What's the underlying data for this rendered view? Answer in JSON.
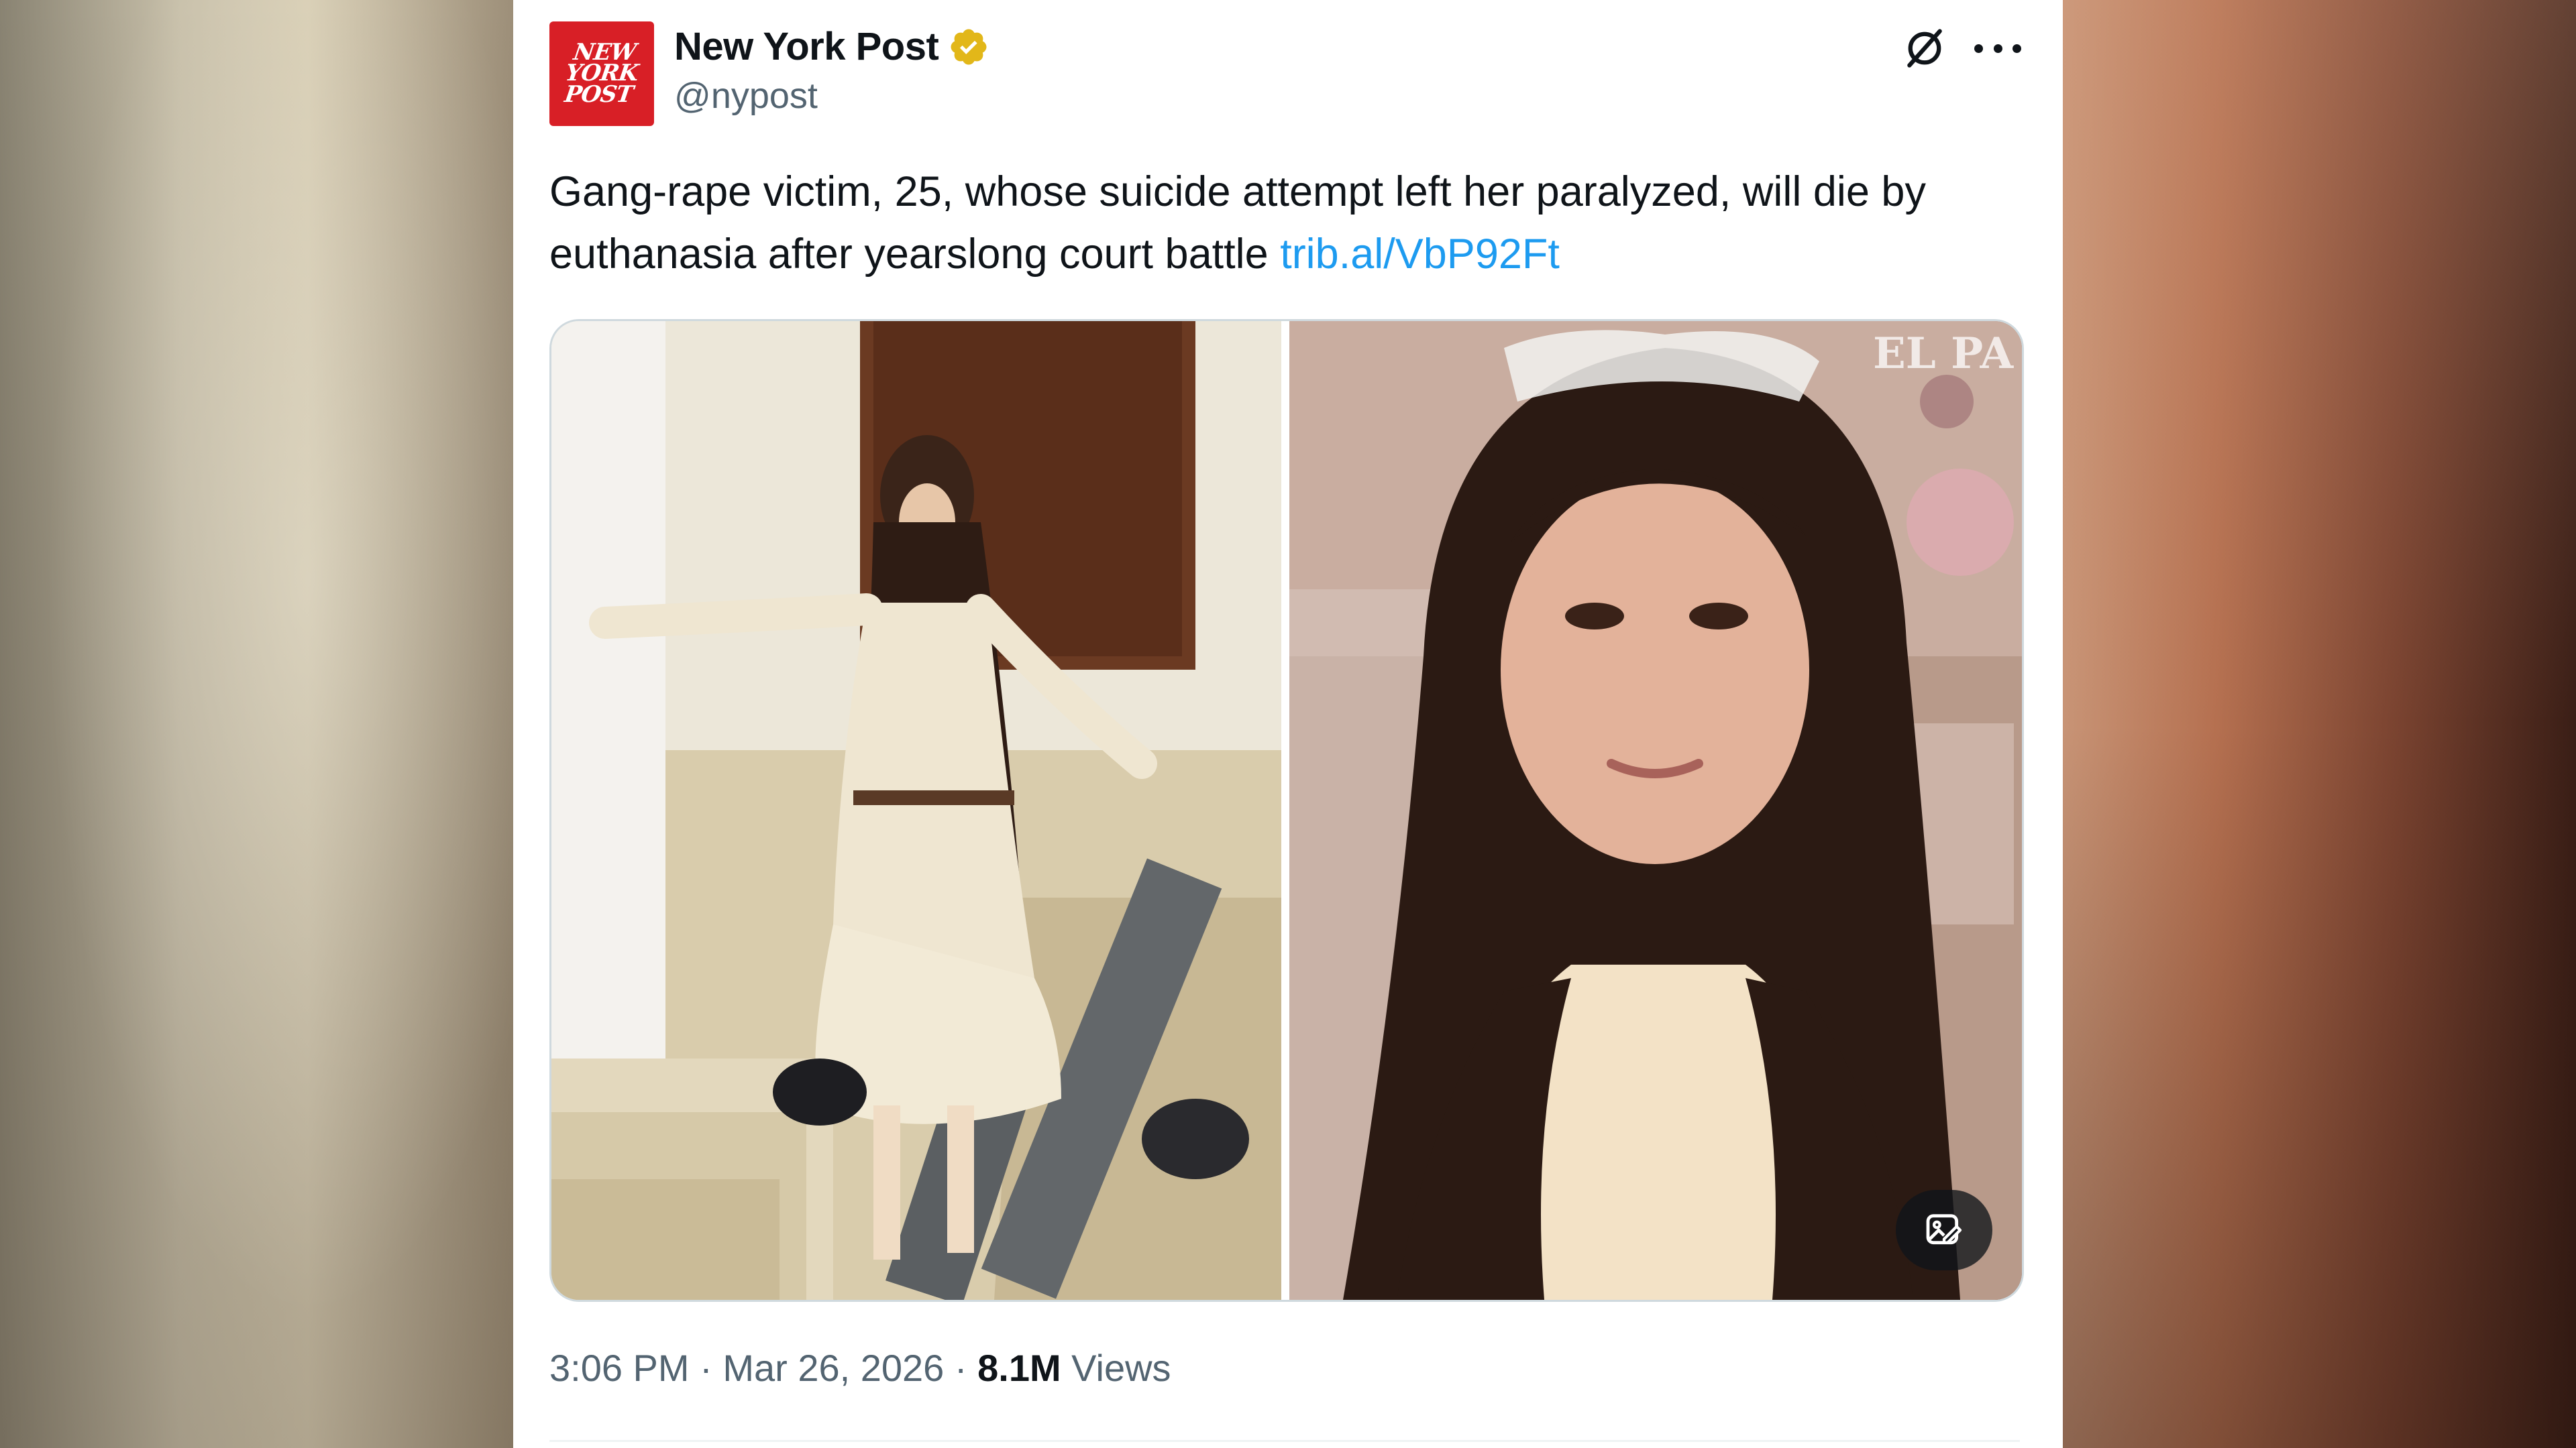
{
  "tweet": {
    "author": {
      "display_name": "New York Post",
      "handle": "@nypost",
      "avatar_lines": [
        "NEW",
        "YORK",
        "POST"
      ],
      "verified": true,
      "verified_color": "#e2b719"
    },
    "text": "Gang-rape victim, 25, whose suicide attempt left her paralyzed, will die by euthanasia after yearslong court battle ",
    "link": "trib.al/VbP92Ft",
    "media_watermark": "EL PA",
    "time": "3:06 PM",
    "separator": "·",
    "date": "Mar 26, 2026",
    "views_count": "8.1M",
    "views_label": "Views",
    "icons": [
      "grok-icon",
      "more-icon",
      "edit-image-icon",
      "verified-badge-icon"
    ]
  },
  "colors": {
    "link": "#1d9bf0",
    "text_primary": "#0f1419",
    "text_secondary": "#536471",
    "brand": "#d81f26"
  }
}
